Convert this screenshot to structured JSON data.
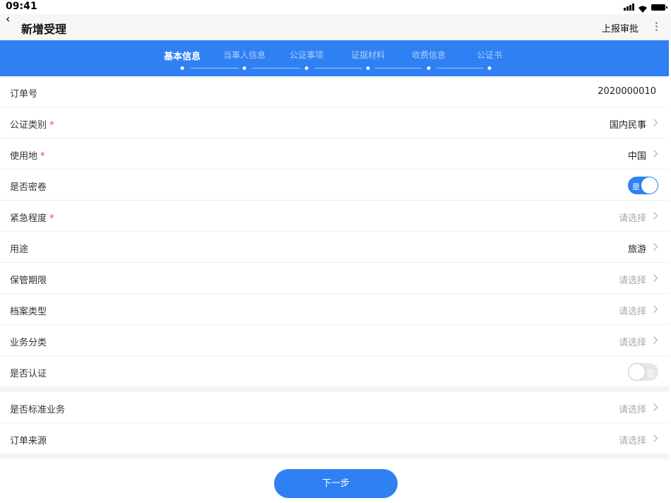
{
  "status": {
    "time": "09:41"
  },
  "nav": {
    "title": "新增受理",
    "report_label": "上报审批"
  },
  "steps": [
    {
      "label": "基本信息",
      "active": true
    },
    {
      "label": "当事人信息",
      "active": false
    },
    {
      "label": "公证事项",
      "active": false
    },
    {
      "label": "证据材料",
      "active": false
    },
    {
      "label": "收费信息",
      "active": false
    },
    {
      "label": "公证书",
      "active": false
    }
  ],
  "form": {
    "order_no": {
      "label": "订单号",
      "value": "2020000010"
    },
    "category": {
      "label": "公证类别",
      "required": "*",
      "value": "国内民事"
    },
    "usage_place": {
      "label": "使用地",
      "required": "*",
      "value": "中国"
    },
    "sealed": {
      "label": "是否密卷",
      "state": "是"
    },
    "urgency": {
      "label": "紧急程度",
      "required": "*",
      "placeholder": "请选择"
    },
    "purpose": {
      "label": "用途",
      "value": "旅游"
    },
    "retention": {
      "label": "保管期限",
      "placeholder": "请选择"
    },
    "archive_type": {
      "label": "档案类型",
      "placeholder": "请选择"
    },
    "business_class": {
      "label": "业务分类",
      "placeholder": "请选择"
    },
    "certified": {
      "label": "是否认证",
      "state": "否"
    },
    "standard_business": {
      "label": "是否标准业务",
      "placeholder": "请选择"
    },
    "order_source": {
      "label": "订单来源",
      "placeholder": "请选择"
    }
  },
  "footer": {
    "next_label": "下一步"
  },
  "colors": {
    "accent": "#2f80f2",
    "required": "#f0413a",
    "placeholder": "#aaaaaa"
  }
}
